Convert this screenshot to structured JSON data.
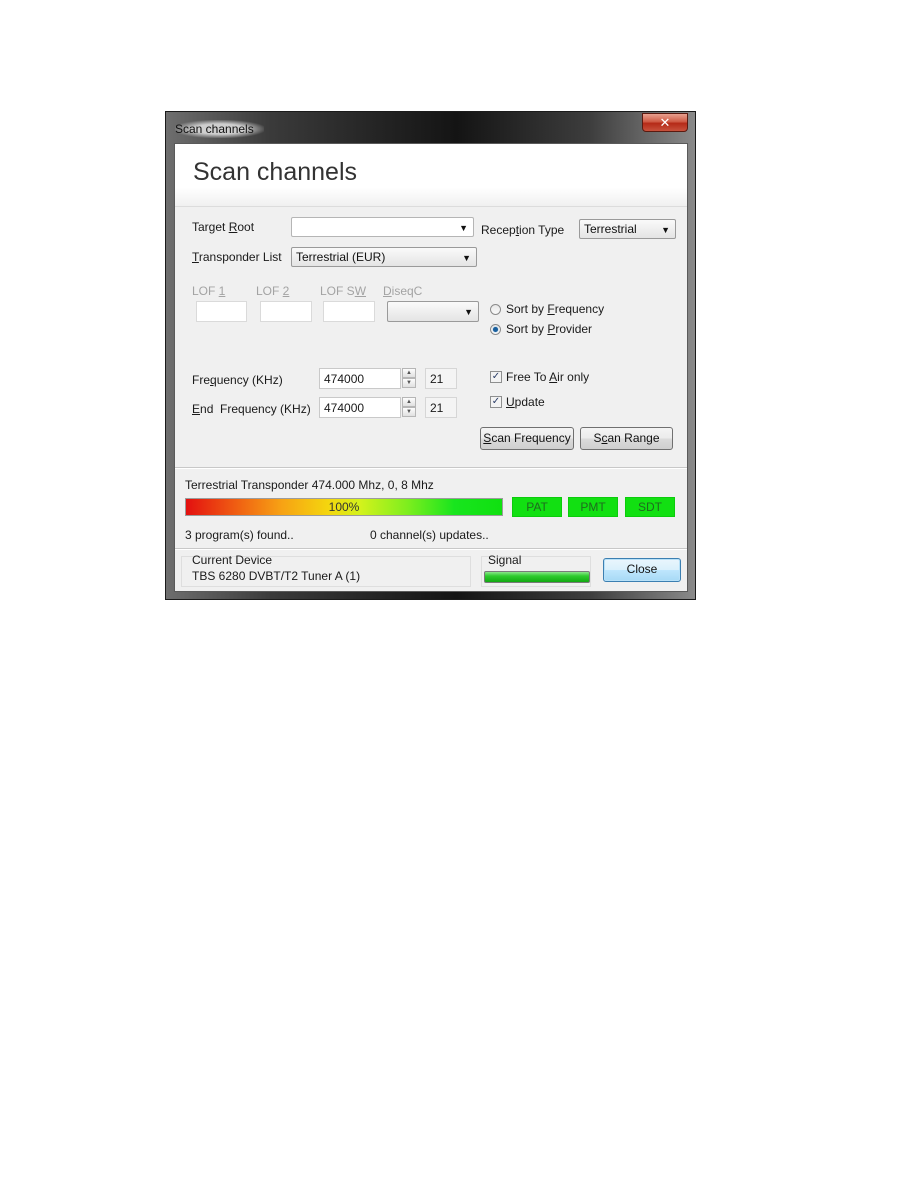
{
  "window": {
    "title": "Scan channels",
    "close_glyph": "✕"
  },
  "header": {
    "title": "Scan channels"
  },
  "form": {
    "target_root": {
      "label_pre": "Target ",
      "label_key": "R",
      "label_post": "oot",
      "value": ""
    },
    "reception_type": {
      "label_pre": "Recep",
      "label_key": "t",
      "label_post": "ion Type",
      "value": "Terrestrial"
    },
    "transponder_list": {
      "label_pre": "",
      "label_key": "T",
      "label_post": "ransponder List",
      "value": "Terrestrial (EUR)"
    },
    "lof1": {
      "label_pre": "LOF ",
      "label_key": "1",
      "label_post": "",
      "value": ""
    },
    "lof2": {
      "label_pre": "LOF ",
      "label_key": "2",
      "label_post": "",
      "value": ""
    },
    "lofsw": {
      "label_pre": "LOF S",
      "label_key": "W",
      "label_post": "",
      "value": ""
    },
    "diseqc": {
      "label_pre": "",
      "label_key": "D",
      "label_post": "iseqC",
      "value": ""
    },
    "sort_frequency": {
      "label_pre": "Sort by ",
      "label_key": "F",
      "label_post": "requency",
      "selected": false
    },
    "sort_provider": {
      "label_pre": "Sort by ",
      "label_key": "P",
      "label_post": "rovider",
      "selected": true
    },
    "frequency": {
      "label_pre": "Fre",
      "label_key": "q",
      "label_post": "uency (KHz)",
      "value": "474000",
      "channel": "21"
    },
    "end_frequency": {
      "label_pre": "",
      "label_key": "E",
      "label_post": "nd  Frequency (KHz)",
      "value": "474000",
      "channel": "21"
    },
    "free_to_air": {
      "label_pre": "Free To ",
      "label_key": "A",
      "label_post": "ir only",
      "checked": true
    },
    "update": {
      "label_pre": "",
      "label_key": "U",
      "label_post": "pdate",
      "checked": true
    },
    "scan_frequency_button": {
      "label_pre": "",
      "label_key": "S",
      "label_post": "can Frequency"
    },
    "scan_range_button": {
      "label_pre": "S",
      "label_key": "c",
      "label_post": "an Range"
    }
  },
  "status": {
    "transponder_text": "Terrestrial Transponder 474.000 Mhz, 0, 8 Mhz",
    "progress_percent": 100,
    "progress_label": "100%",
    "tables": [
      "PAT",
      "PMT",
      "SDT"
    ],
    "programs_found": "3 program(s) found..",
    "channel_updates": "0 channel(s) updates.."
  },
  "footer": {
    "device_label": "Current Device",
    "device_name": "TBS 6280 DVBT/T2 Tuner A (1)",
    "signal_label": "Signal",
    "signal_level": 1.0,
    "close_button": "Close"
  },
  "icons": {
    "dropdown": "▼",
    "spin_up": "▲",
    "spin_down": "▼",
    "check": "✓"
  },
  "colors": {
    "tag_green": "#12e012",
    "signal_green": "#13a913",
    "close_red": "#c8513c"
  }
}
